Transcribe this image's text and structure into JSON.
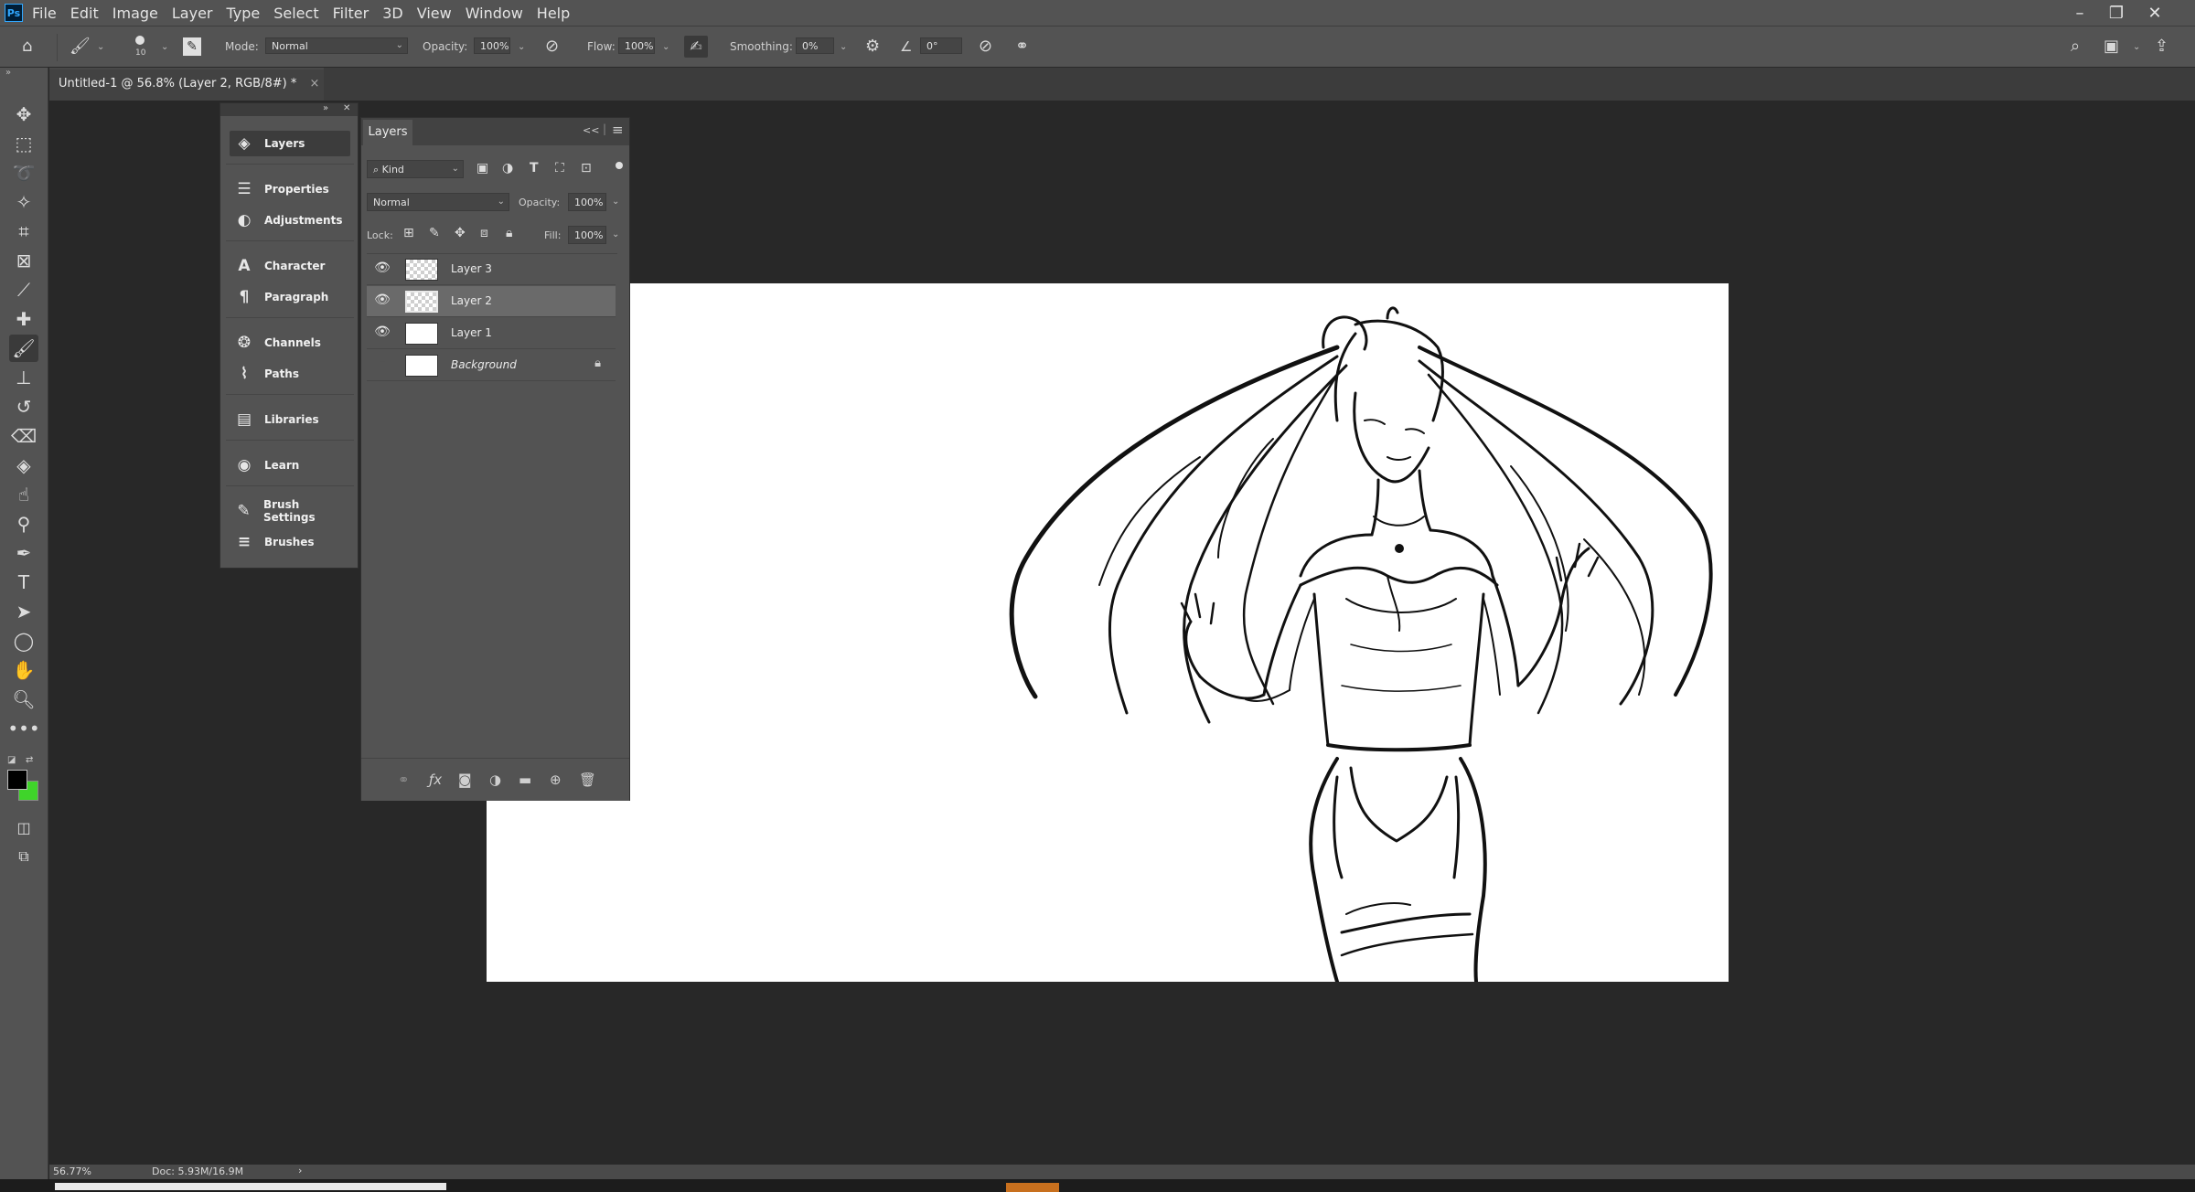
{
  "app": {
    "logo_text": "Ps"
  },
  "menu": [
    "File",
    "Edit",
    "Image",
    "Layer",
    "Type",
    "Select",
    "Filter",
    "3D",
    "View",
    "Window",
    "Help"
  ],
  "window_controls": {
    "minimize": "–",
    "restore": "❐",
    "close": "✕"
  },
  "options_bar": {
    "brush_size": "10",
    "mode_label": "Mode:",
    "mode_value": "Normal",
    "opacity_label": "Opacity:",
    "opacity_value": "100%",
    "flow_label": "Flow:",
    "flow_value": "100%",
    "smoothing_label": "Smoothing:",
    "smoothing_value": "0%",
    "angle_value": "0°"
  },
  "document": {
    "tab_title": "Untitled-1 @ 56.8% (Layer 2, RGB/8#) *",
    "tab_close": "×"
  },
  "dock": {
    "items": [
      {
        "label": "Layers",
        "icon": "layers-icon",
        "active": true
      },
      {
        "label": "Properties",
        "icon": "properties-icon"
      },
      {
        "label": "Adjustments",
        "icon": "adjustments-icon"
      },
      {
        "label": "Character",
        "icon": "character-icon"
      },
      {
        "label": "Paragraph",
        "icon": "paragraph-icon"
      },
      {
        "label": "Channels",
        "icon": "channels-icon"
      },
      {
        "label": "Paths",
        "icon": "paths-icon"
      },
      {
        "label": "Libraries",
        "icon": "libraries-icon"
      },
      {
        "label": "Learn",
        "icon": "learn-icon"
      },
      {
        "label": "Brush Settings",
        "icon": "brush-settings-icon"
      },
      {
        "label": "Brushes",
        "icon": "brushes-icon"
      }
    ]
  },
  "layers_panel": {
    "tab": "Layers",
    "collapse": "<<",
    "filter_kind": "Kind",
    "blend_mode": "Normal",
    "opacity_label": "Opacity:",
    "opacity_value": "100%",
    "lock_label": "Lock:",
    "fill_label": "Fill:",
    "fill_value": "100%",
    "layers": [
      {
        "name": "Layer 3",
        "visible": true,
        "thumb": "checker",
        "selected": false
      },
      {
        "name": "Layer 2",
        "visible": true,
        "thumb": "checker",
        "selected": true
      },
      {
        "name": "Layer 1",
        "visible": true,
        "thumb": "white",
        "selected": false
      },
      {
        "name": "Background",
        "visible": false,
        "thumb": "white",
        "selected": false,
        "locked": true
      }
    ]
  },
  "status": {
    "zoom": "56.77%",
    "doc": "Doc: 5.93M/16.9M",
    "arrow": "›"
  },
  "colors": {
    "foreground": "#000000",
    "background": "#3fd42a",
    "accent": "#31a8ff",
    "taskbar_active": "#c8701e"
  }
}
